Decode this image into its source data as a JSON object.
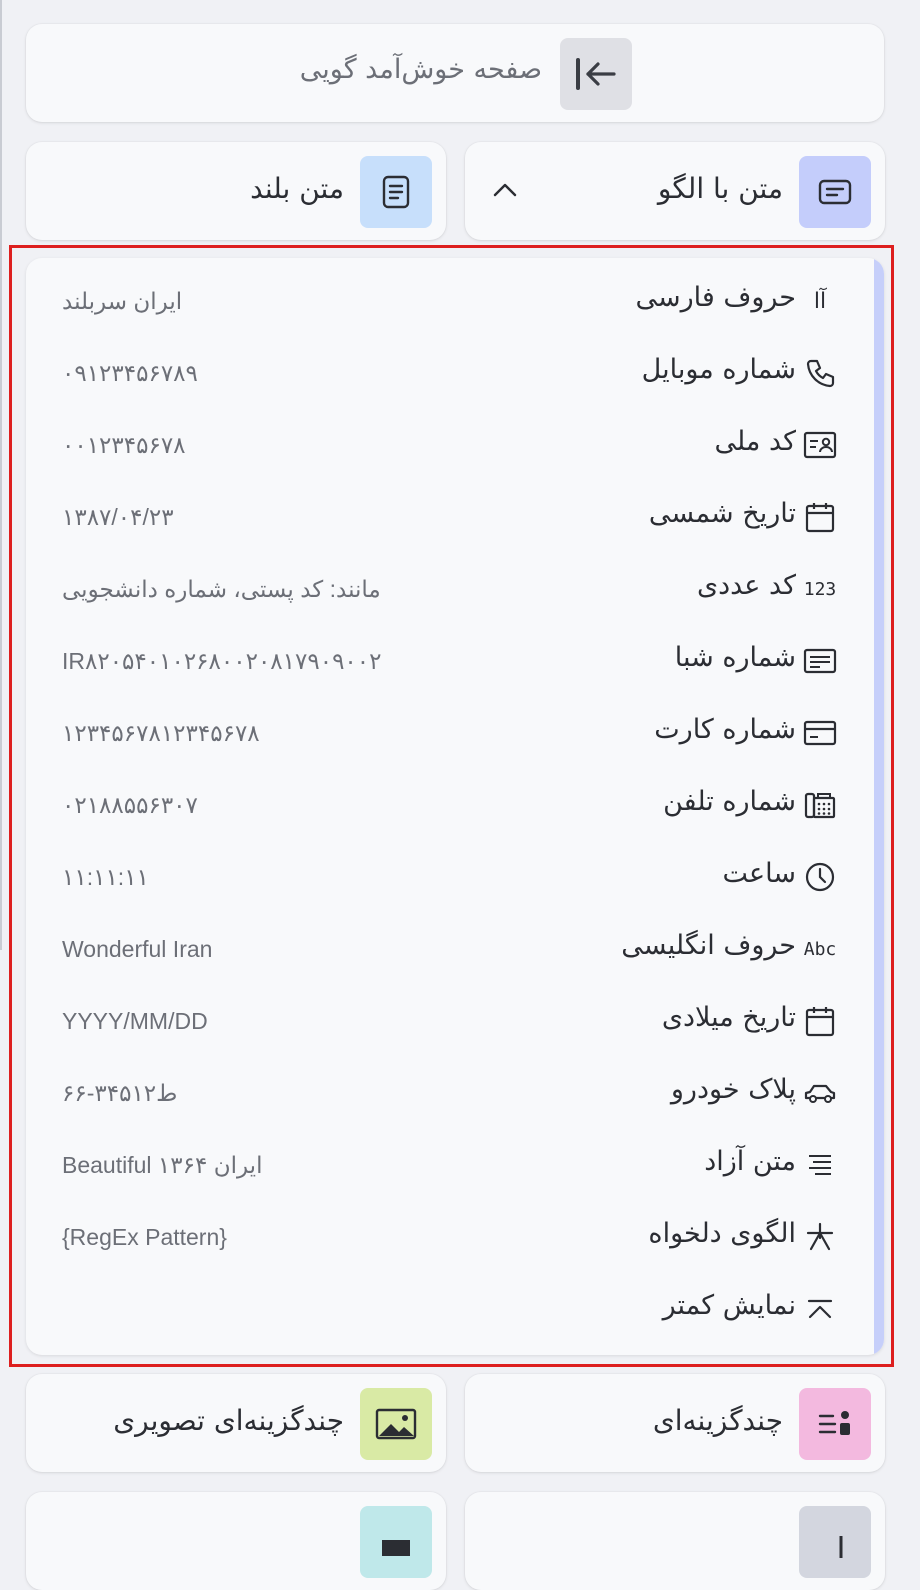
{
  "welcome": {
    "label": "صفحه خوش‌آمد گویی",
    "icon": "collapse-arrow-icon"
  },
  "tiles_top": {
    "text_pattern": {
      "label": "متن با الگو",
      "icon": "text-pattern-icon",
      "icon_bg": "#c4cdfb"
    },
    "long_text": {
      "label": "متن بلند",
      "icon": "document-icon",
      "icon_bg": "#c7dffb"
    }
  },
  "pattern_items": [
    {
      "label": "حروف فارسی",
      "example": "ایران سربلند",
      "icon": "persian-letters-icon",
      "glyph": "آا"
    },
    {
      "label": "شماره موبایل",
      "example": "۰۹۱۲۳۴۵۶۷۸۹",
      "icon": "phone-icon",
      "glyph": ""
    },
    {
      "label": "کد ملی",
      "example": "۰۰۱۲۳۴۵۶۷۸",
      "icon": "id-card-icon",
      "glyph": ""
    },
    {
      "label": "تاریخ شمسی",
      "example": "۱۳۸۷/۰۴/۲۳",
      "icon": "calendar-icon",
      "glyph": ""
    },
    {
      "label": "کد عددی",
      "example": "مانند: کد پستی، شماره دانشجویی",
      "icon": "numbers-icon",
      "glyph": "123"
    },
    {
      "label": "شماره شبا",
      "example": "IR۸۲۰۵۴۰۱۰۲۶۸۰۰۲۰۸۱۷۹۰۹۰۰۲",
      "icon": "iban-icon",
      "glyph": ""
    },
    {
      "label": "شماره کارت",
      "example": "۱۲۳۴۵۶۷۸۱۲۳۴۵۶۷۸",
      "icon": "credit-card-icon",
      "glyph": ""
    },
    {
      "label": "شماره تلفن",
      "example": "۰۲۱۸۸۵۵۶۳۰۷",
      "icon": "landline-phone-icon",
      "glyph": ""
    },
    {
      "label": "ساعت",
      "example": "۱۱:۱۱:۱۱",
      "icon": "clock-icon",
      "glyph": ""
    },
    {
      "label": "حروف انگلیسی",
      "example": "Wonderful Iran",
      "icon": "abc-icon",
      "glyph": "Abc"
    },
    {
      "label": "تاریخ میلادی",
      "example": "YYYY/MM/DD",
      "icon": "calendar-icon",
      "glyph": ""
    },
    {
      "label": "پلاک خودرو",
      "example": "۶۶-۳۴۵ط۱۲",
      "icon": "car-icon",
      "glyph": ""
    },
    {
      "label": "متن آزاد",
      "example": "Beautiful ۱۳۶۴ ایران",
      "icon": "free-text-icon",
      "glyph": ""
    },
    {
      "label": "الگوی دلخواه",
      "example": "{RegEx Pattern}",
      "icon": "asterisk-icon",
      "glyph": ""
    },
    {
      "label": "نمایش کمتر",
      "example": "",
      "icon": "show-less-icon",
      "glyph": ""
    }
  ],
  "tiles_bottom": {
    "multiple_choice": {
      "label": "چندگزینه‌ای",
      "icon": "multiple-choice-icon",
      "icon_bg": "#f3b9df"
    },
    "image_choice": {
      "label": "چندگزینه‌ای تصویری",
      "icon": "image-icon",
      "icon_bg": "#d9eaa5"
    }
  },
  "colors": {
    "highlight": "#dd1f1f",
    "scrollbar": "#c6cffa"
  }
}
